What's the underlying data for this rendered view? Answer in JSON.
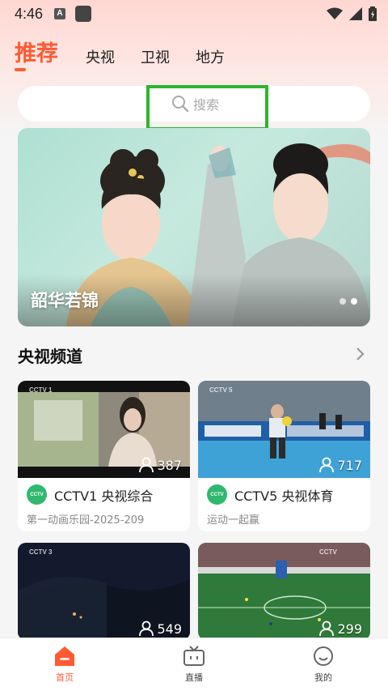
{
  "status_bar": {
    "time": "4:46",
    "a_badge": "A"
  },
  "tabs": [
    {
      "label": "推荐",
      "active": true
    },
    {
      "label": "央视"
    },
    {
      "label": "卫视"
    },
    {
      "label": "地方"
    }
  ],
  "search": {
    "placeholder": "搜索"
  },
  "banner": {
    "title": "韶华若锦",
    "page_count": 2,
    "active_page": 1
  },
  "section": {
    "title": "央视频道"
  },
  "cards": [
    {
      "channel_logo_text": "CCTV",
      "channel": "CCTV1 央视综合",
      "program": "第一动画乐园-2025-209",
      "viewers": "387",
      "thumb_logo": "CCTV 1"
    },
    {
      "channel_logo_text": "CCTV",
      "channel": "CCTV5 央视体育",
      "program": "运动一起赢",
      "viewers": "717",
      "thumb_logo": "CCTV 5"
    },
    {
      "viewers": "549",
      "thumb_logo": "CCTV 3"
    },
    {
      "viewers": "299",
      "thumb_logo": "CCTV"
    }
  ],
  "bottom_nav": [
    {
      "label": "首页",
      "icon": "home-icon",
      "active": true
    },
    {
      "label": "直播",
      "icon": "tv-icon"
    },
    {
      "label": "我的",
      "icon": "smile-icon"
    }
  ],
  "colors": {
    "accent": "#ff5a33",
    "highlight_box": "#2db52d",
    "channel_logo": "#2fb86e"
  }
}
